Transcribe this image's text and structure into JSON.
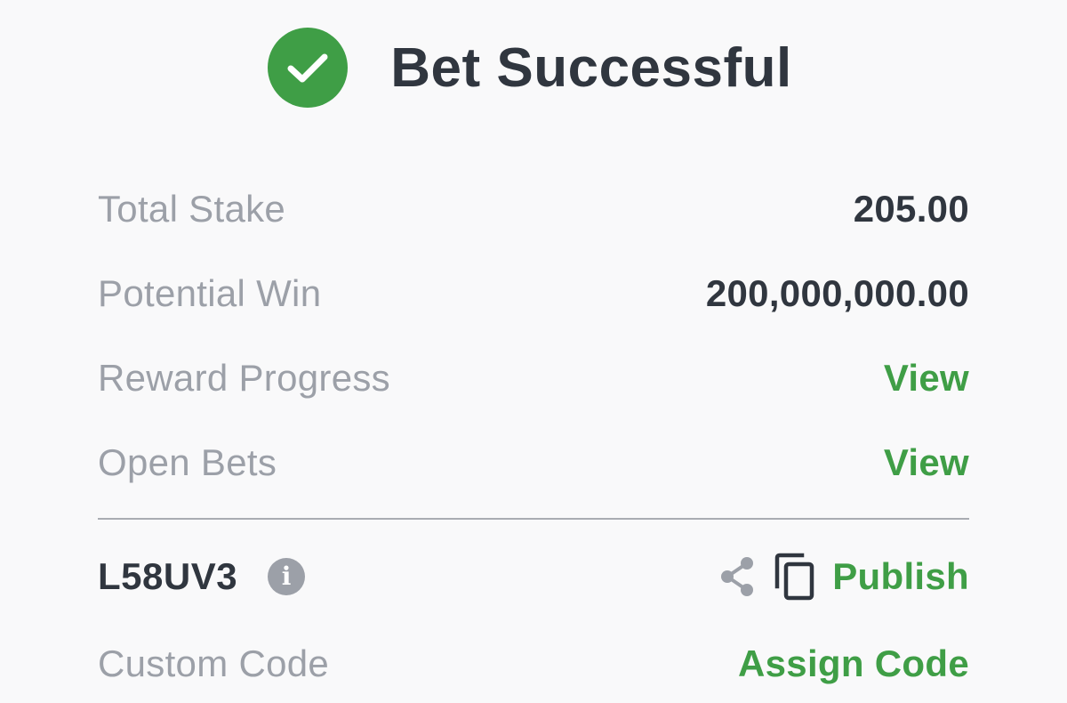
{
  "header": {
    "title": "Bet Successful",
    "icon": "check-circle-icon"
  },
  "summary": {
    "total_stake": {
      "label": "Total Stake",
      "value": "205.00"
    },
    "potential_win": {
      "label": "Potential Win",
      "value": "200,000,000.00"
    },
    "reward_progress": {
      "label": "Reward Progress",
      "link": "View"
    },
    "open_bets": {
      "label": "Open Bets",
      "link": "View"
    }
  },
  "booking": {
    "code": "L58UV3",
    "info_icon_glyph": "i",
    "info_icon": "info-icon",
    "share_icon": "share-icon",
    "copy_icon": "copy-icon",
    "publish_label": "Publish"
  },
  "custom_code": {
    "label": "Custom Code",
    "link": "Assign Code"
  },
  "colors": {
    "accent": "#3f9e46",
    "text_dark": "#30363f",
    "text_muted": "#9ca0a8",
    "background": "#f9f9fa"
  }
}
